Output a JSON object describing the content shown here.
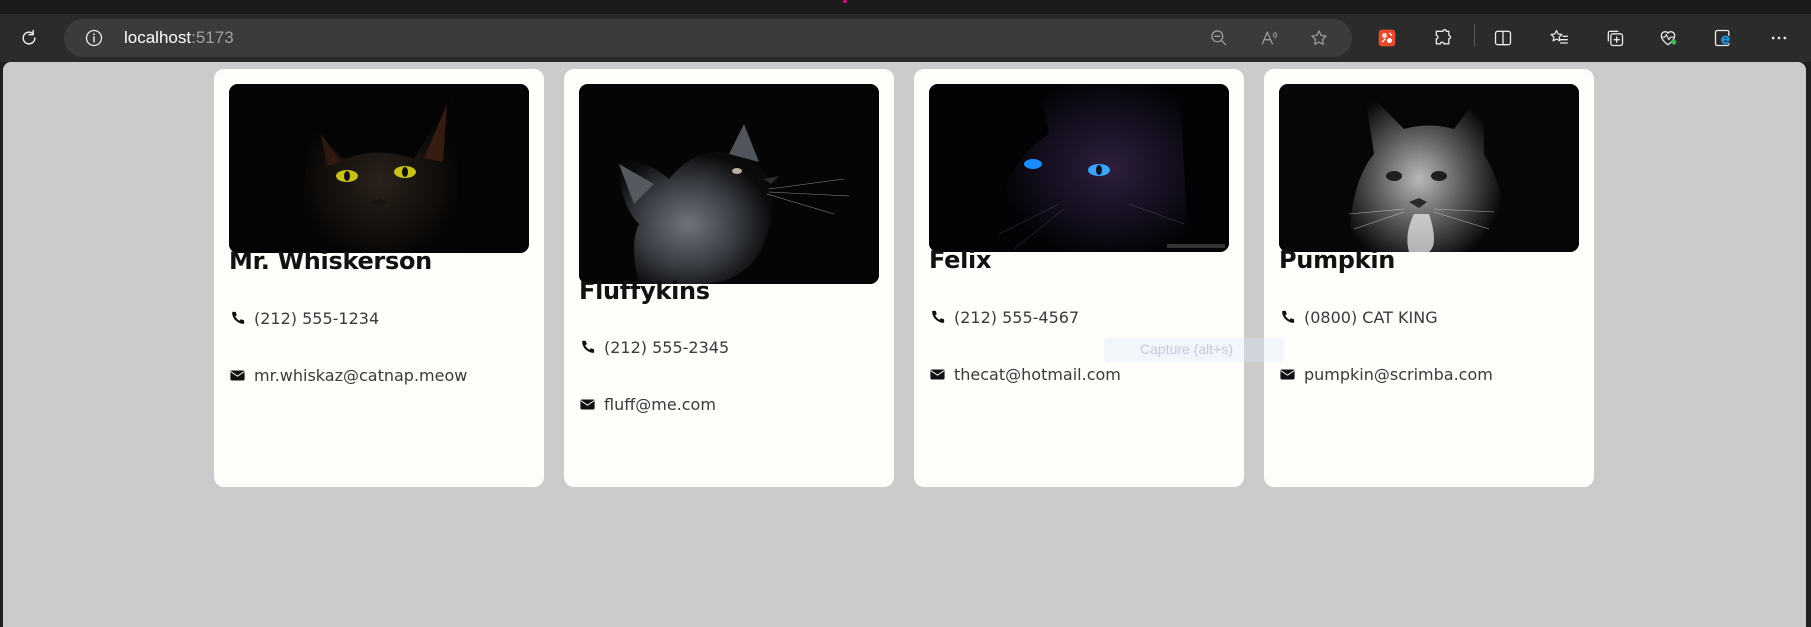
{
  "browser": {
    "url_host": "localhost",
    "url_port": ":5173"
  },
  "overlay": {
    "ghost_text": "Capture (alt+s)"
  },
  "cards": [
    {
      "name": "Mr. Whiskerson",
      "phone": "(212) 555-1234",
      "email": "mr.whiskaz@catnap.meow"
    },
    {
      "name": "Fluffykins",
      "phone": "(212) 555-2345",
      "email": "fluff@me.com"
    },
    {
      "name": "Felix",
      "phone": "(212) 555-4567",
      "email": "thecat@hotmail.com"
    },
    {
      "name": "Pumpkin",
      "phone": "(0800) CAT KING",
      "email": "pumpkin@scrimba.com"
    }
  ],
  "icons": {
    "phone": "phone-icon",
    "email": "envelope-icon"
  },
  "colors": {
    "page_bg": "#cbcbcb",
    "card_bg": "#fdfdfa",
    "toolbar_bg": "#2b2b2b"
  }
}
